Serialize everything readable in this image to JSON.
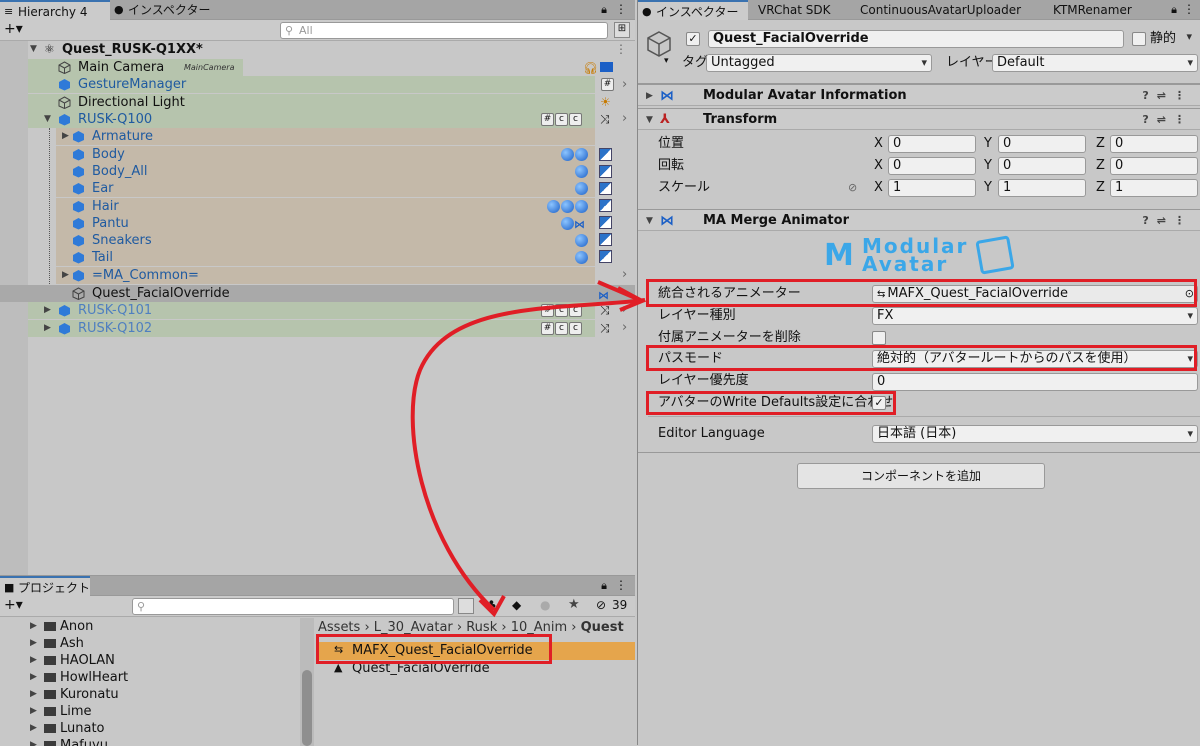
{
  "hierarchy": {
    "tab_label": "Hierarchy 4",
    "inspector_tab_label": "インスペクター",
    "search_placeholder": "All",
    "root": "Quest_RUSK-Q1XX*",
    "rows": [
      {
        "name": "Main Camera",
        "tag": "MainCamera"
      },
      {
        "name": "GestureManager"
      },
      {
        "name": "Directional Light"
      },
      {
        "name": "RUSK-Q100"
      },
      {
        "name": "Armature"
      },
      {
        "name": "Body"
      },
      {
        "name": "Body_All"
      },
      {
        "name": "Ear"
      },
      {
        "name": "Hair"
      },
      {
        "name": "Pantu"
      },
      {
        "name": "Sneakers"
      },
      {
        "name": "Tail"
      },
      {
        "name": "=MA_Common="
      },
      {
        "name": "Quest_FacialOverride"
      },
      {
        "name": "RUSK-Q101"
      },
      {
        "name": "RUSK-Q102"
      }
    ]
  },
  "project": {
    "tab_label": "プロジェクト",
    "hidden_count": "39",
    "folders": [
      "Anon",
      "Ash",
      "HAOLAN",
      "HowlHeart",
      "Kuronatu",
      "Lime",
      "Lunato",
      "Mafuyu"
    ],
    "breadcrumb": [
      "Assets",
      "L_30_Avatar",
      "Rusk",
      "10_Anim",
      "Quest"
    ],
    "assets": [
      "MAFX_Quest_FacialOverride",
      "Quest_FacialOverride"
    ]
  },
  "inspector": {
    "tabs": [
      "インスペクター",
      "VRChat SDK",
      "ContinuousAvatarUploader",
      "KTMRenamer"
    ],
    "object_name": "Quest_FacialOverride",
    "static_label": "静的",
    "tag_label": "タグ",
    "tag_value": "Untagged",
    "layer_label": "レイヤー",
    "layer_value": "Default",
    "components": {
      "info": "Modular Avatar Information",
      "transform": "Transform",
      "merge": "MA Merge Animator"
    },
    "transform": {
      "position_label": "位置",
      "rotation_label": "回転",
      "scale_label": "スケール",
      "axis_x": "X",
      "axis_y": "Y",
      "axis_z": "Z",
      "position": [
        "0",
        "0",
        "0"
      ],
      "rotation": [
        "0",
        "0",
        "0"
      ],
      "scale": [
        "1",
        "1",
        "1"
      ]
    },
    "logo": {
      "line1": "Modular",
      "line2": "Avatar"
    },
    "merge": {
      "animator_label": "統合されるアニメーター",
      "animator_value": "MAFX_Quest_FacialOverride",
      "layer_type_label": "レイヤー種別",
      "layer_type_value": "FX",
      "delete_label": "付属アニメーターを削除",
      "path_mode_label": "パスモード",
      "path_mode_value": "絶対的（アバタールートからのパスを使用）",
      "priority_label": "レイヤー優先度",
      "priority_value": "0",
      "write_defaults_label": "アバターのWrite Defaults設定に合わせ",
      "language_label": "Editor Language",
      "language_value": "日本語 (日本)"
    },
    "add_component": "コンポーネントを追加"
  }
}
